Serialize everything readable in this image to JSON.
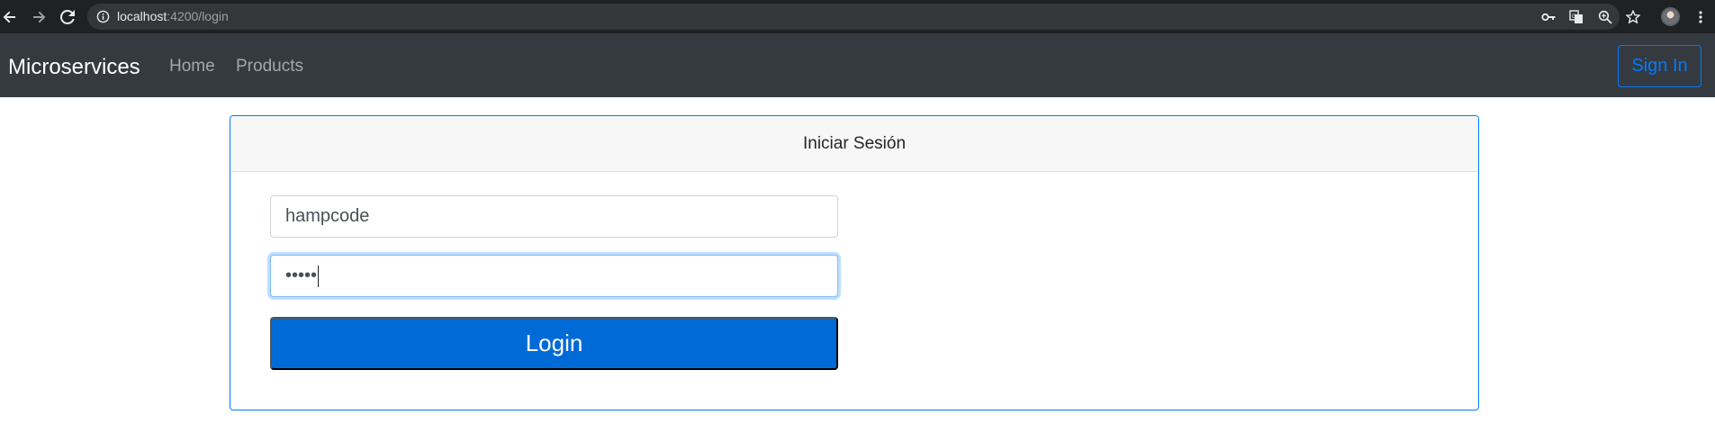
{
  "browser": {
    "url_host": "localhost",
    "url_rest": ":4200/login"
  },
  "navbar": {
    "brand": "Microservices",
    "links": [
      "Home",
      "Products"
    ],
    "sign_in_label": "Sign In"
  },
  "card": {
    "header": "Iniciar Sesión",
    "username_value": "hampcode",
    "password_value": "•••••",
    "login_label": "Login"
  },
  "colors": {
    "primary": "#007bff",
    "button": "#006ad6",
    "navbar": "#343a40",
    "chrome": "#202124"
  }
}
